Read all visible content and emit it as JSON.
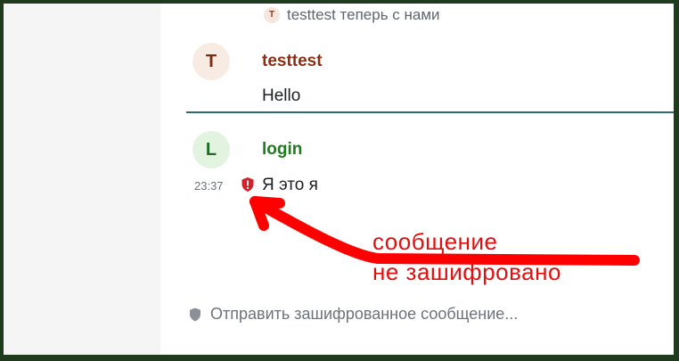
{
  "timeline": {
    "join_event": {
      "avatar_letter": "T",
      "text": "testtest теперь с нами"
    },
    "messages": [
      {
        "avatar_letter": "T",
        "sender": "testtest",
        "body": "Hello",
        "color": "#8b2e13"
      },
      {
        "avatar_letter": "L",
        "sender": "login",
        "body": "Я это я",
        "time": "23:37",
        "color": "#1f7a20",
        "status_icon": "unencrypted-shield-icon"
      }
    ],
    "read_marker_color": "#2f6e68"
  },
  "annotation": {
    "line1": "сообщение",
    "line2": "не зашифровано",
    "color": "#e01010"
  },
  "composer": {
    "placeholder": "Отправить зашифрованное сообщение...",
    "icon": "shield-icon"
  }
}
